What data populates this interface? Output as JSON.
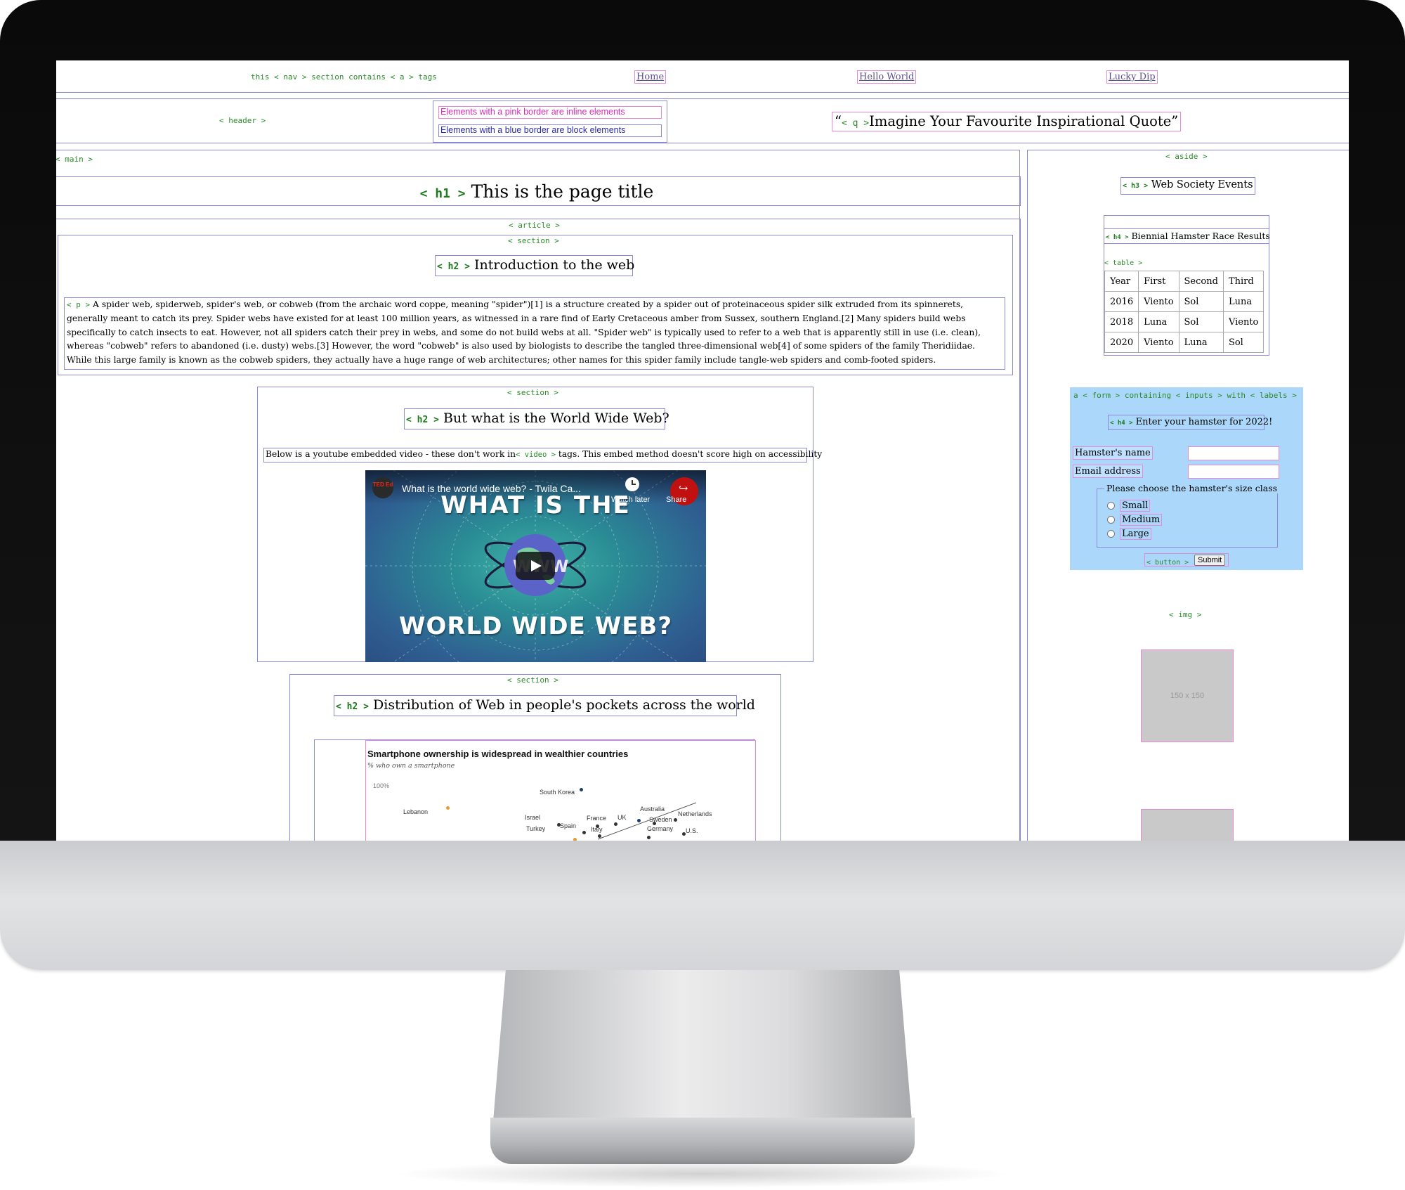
{
  "nav": {
    "tag_note": "this < nav > section contains < a > tags",
    "links": [
      "Home",
      "Hello World",
      "Lucky Dip"
    ]
  },
  "header": {
    "tag": "< header >",
    "legend_inline": "Elements with a pink border are inline elements",
    "legend_block": "Elements with a blue border are block elements",
    "quote_open": "“",
    "quote_tag": "< q >",
    "quote_text": "Imagine Your Favourite Inspirational Quote",
    "quote_close": "”"
  },
  "main": {
    "tag": "< main >",
    "h1_tag": "< h1 >",
    "h1": "This is the page title",
    "article_tag": "< article >",
    "section_tag": "< section >",
    "s1": {
      "h2_tag": "< h2 >",
      "h2": "Introduction to the web",
      "p_tag": "< p >",
      "p": "A spider web, spiderweb, spider's web, or cobweb (from the archaic word coppe, meaning \"spider\")[1] is a structure created by a spider out of proteinaceous spider silk extruded from its spinnerets, generally meant to catch its prey. Spider webs have existed for at least 100 million years, as witnessed in a rare find of Early Cretaceous amber from Sussex, southern England.[2] Many spiders build webs specifically to catch insects to eat. However, not all spiders catch their prey in webs, and some do not build webs at all. \"Spider web\" is typically used to refer to a web that is apparently still in use (i.e. clean), whereas \"cobweb\" refers to abandoned (i.e. dusty) webs.[3] However, the word \"cobweb\" is also used by biologists to describe the tangled three-dimensional web[4] of some spiders of the family Theridiidae. While this large family is known as the cobweb spiders, they actually have a huge range of web architectures; other names for this spider family include tangle-web spiders and comb-footed spiders."
    },
    "s2": {
      "h2_tag": "< h2 >",
      "h2": "But what is the World Wide Web?",
      "note_before": "Below is a youtube embedded video - these don't work in",
      "video_tag": "< video >",
      "note_after": "tags. This embed method doesn't score high on accessibility",
      "video": {
        "title": "What is the world wide web? - Twila Ca...",
        "watch_later": "Watch later",
        "share": "Share",
        "channel": "TED Ed",
        "line1": "WHAT IS THE",
        "line2": "WORLD WIDE WEB?",
        "globe_text": "WWW"
      }
    },
    "s3": {
      "h2_tag": "< h2 >",
      "h2": "Distribution of Web in people's pockets across the world",
      "chart_title": "Smartphone ownership is widespread in wealthier countries",
      "chart_subtitle": "% who own a smartphone",
      "chart_ytick": "100%"
    }
  },
  "aside": {
    "tag": "< aside >",
    "h3_tag": "< h3 >",
    "h3": "Web Society Events",
    "h4_tag": "< h4 >",
    "h4": "Biennial Hamster Race Results",
    "table_tag": "< table >",
    "table": {
      "headers": [
        "Year",
        "First",
        "Second",
        "Third"
      ],
      "rows": [
        [
          "2016",
          "Viento",
          "Sol",
          "Luna"
        ],
        [
          "2018",
          "Luna",
          "Sol",
          "Viento"
        ],
        [
          "2020",
          "Viento",
          "Luna",
          "Sol"
        ]
      ]
    },
    "form": {
      "tag_note": "a < form > containing < inputs > with < labels >",
      "h4_tag": "< h4 >",
      "h4": "Enter your hamster for 2022!",
      "name_label": "Hamster's name",
      "email_label": "Email address",
      "legend": "Please choose the hamster's size class",
      "options": [
        "Small",
        "Medium",
        "Large"
      ],
      "button_tag": "< button >",
      "submit": "Submit"
    },
    "img_tag": "< img >",
    "img_placeholder": "150 x 150"
  },
  "chart_data": {
    "type": "scatter",
    "title": "Smartphone ownership is widespread in wealthier countries",
    "subtitle": "% who own a smartphone",
    "ytick": "100%",
    "points": [
      {
        "label": "South Korea",
        "group": "advanced"
      },
      {
        "label": "Lebanon",
        "group": "emerging"
      },
      {
        "label": "Israel",
        "group": "advanced"
      },
      {
        "label": "France",
        "group": "advanced"
      },
      {
        "label": "UK",
        "group": "advanced"
      },
      {
        "label": "Australia",
        "group": "advanced"
      },
      {
        "label": "Netherlands",
        "group": "advanced"
      },
      {
        "label": "Sweden",
        "group": "advanced"
      },
      {
        "label": "Spain",
        "group": "advanced"
      },
      {
        "label": "Italy",
        "group": "advanced"
      },
      {
        "label": "Turkey",
        "group": "emerging"
      },
      {
        "label": "U.S.",
        "group": "advanced"
      },
      {
        "label": "Germany",
        "group": "advanced"
      }
    ]
  }
}
